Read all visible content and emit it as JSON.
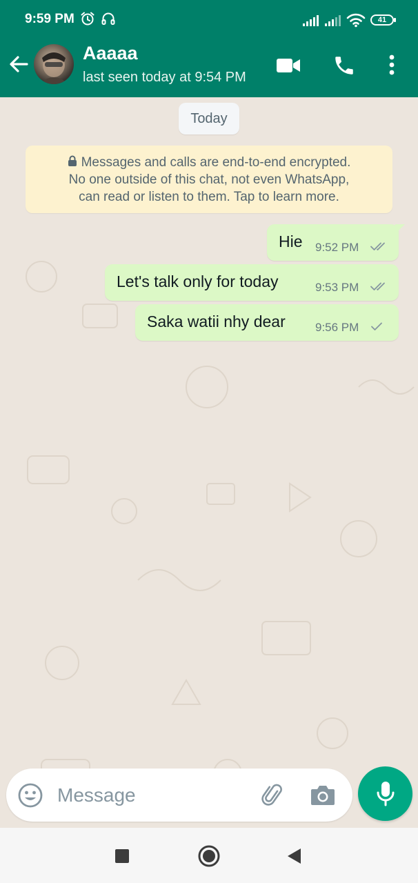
{
  "status_bar": {
    "time": "9:59 PM",
    "battery": "41",
    "icons": [
      "alarm-icon",
      "headphones-icon",
      "signal-icon",
      "signal-icon",
      "wifi-icon",
      "battery-icon"
    ]
  },
  "header": {
    "contact_name": "Aaaaa",
    "last_seen": "last seen today at 9:54 PM",
    "icons": [
      "back-arrow-icon",
      "video-call-icon",
      "voice-call-icon",
      "more-options-icon"
    ]
  },
  "chat": {
    "date_chip": "Today",
    "encryption_notice": {
      "line1": "Messages and calls are end-to-end encrypted.",
      "line2": "No one outside of this chat, not even WhatsApp,",
      "line3": "can read or listen to them. Tap to learn more."
    },
    "messages": [
      {
        "text": "Hie",
        "time": "9:52 PM",
        "status": "read"
      },
      {
        "text": "Let's talk only for today",
        "time": "9:53 PM",
        "status": "read"
      },
      {
        "text": "Saka watii nhy dear",
        "time": "9:56 PM",
        "status": "sent"
      }
    ]
  },
  "composer": {
    "placeholder": "Message",
    "icons": [
      "emoji-icon",
      "attach-icon",
      "camera-icon",
      "mic-icon"
    ]
  },
  "colors": {
    "header": "#008069",
    "outgoing_bubble": "#dcf8c6",
    "chat_background": "#ece5dd",
    "accent": "#00a884"
  }
}
